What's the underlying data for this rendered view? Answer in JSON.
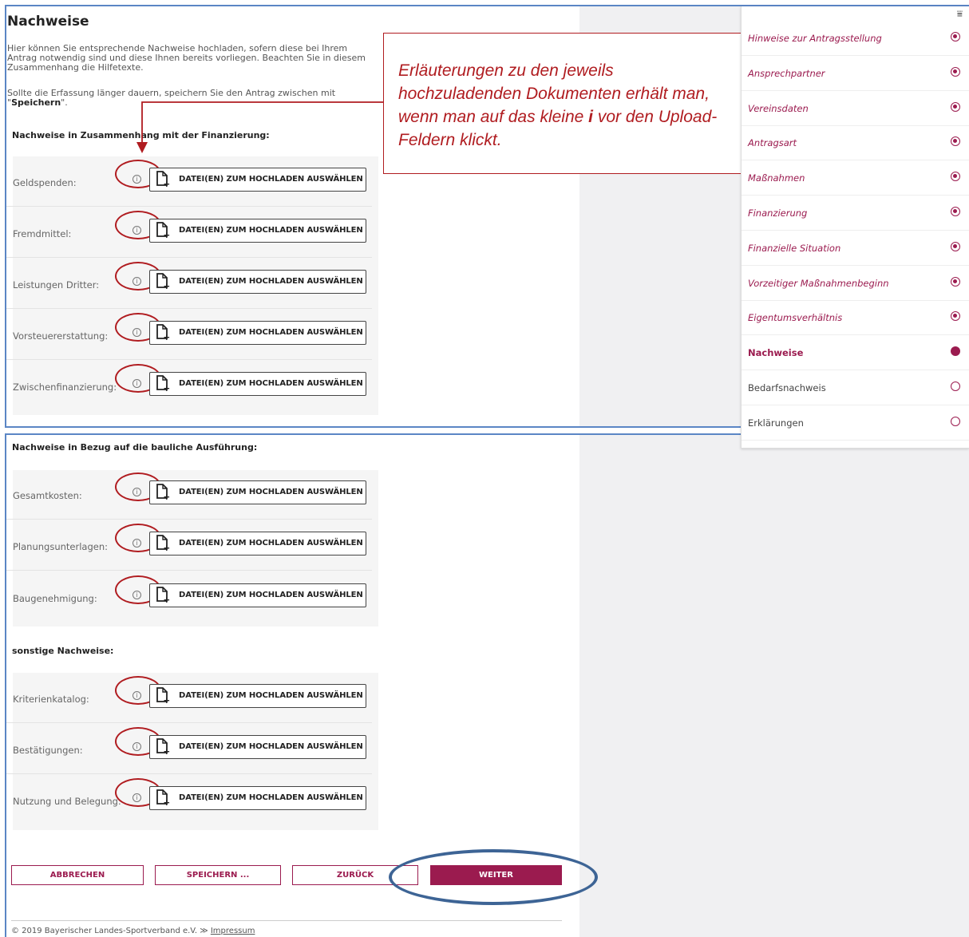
{
  "page": {
    "title": "Nachweise",
    "intro_1": "Hier können Sie entsprechende Nachweise hochladen, sofern diese bei Ihrem Antrag notwendig sind und diese Ihnen bereits vorliegen. Beachten Sie in diesem Zusammenhang die Hilfetexte.",
    "intro_2_pre": "Sollte die Erfassung länger dauern, speichern Sie den Antrag zwischen mit \"",
    "intro_2_bold": "Speichern",
    "intro_2_post": "\"."
  },
  "upload_button_label": "DATEI(EN) ZUM HOCHLADEN AUSWÄHLEN",
  "info_glyph": "i",
  "sections": [
    {
      "heading": "Nachweise in Zusammenhang mit der Finanzierung:",
      "items": [
        "Geldspenden:",
        "Fremdmittel:",
        "Leistungen Dritter:",
        "Vorsteuererstattung:",
        "Zwischenfinanzierung:"
      ]
    },
    {
      "heading": "Nachweise in Bezug auf die bauliche Ausführung:",
      "items": [
        "Gesamtkosten:",
        "Planungsunterlagen:",
        "Baugenehmigung:"
      ]
    },
    {
      "heading": "sonstige Nachweise:",
      "items": [
        "Kriterienkatalog:",
        "Bestätigungen:",
        "Nutzung und Belegung:"
      ]
    }
  ],
  "callout": {
    "text_a": "Erläuterungen zu den jeweils hochzuladenden Dokumenten erhält man, wenn man auf das kleine ",
    "text_i": "i",
    "text_b": " vor den Upload-Feldern klickt.",
    "color": "#b01c20"
  },
  "sidebar": {
    "filter_icon": "filter-icon",
    "items": [
      {
        "label": "Hinweise zur Antragsstellung",
        "status": "done"
      },
      {
        "label": "Ansprechpartner",
        "status": "done"
      },
      {
        "label": "Vereinsdaten",
        "status": "done"
      },
      {
        "label": "Antragsart",
        "status": "done"
      },
      {
        "label": "Maßnahmen",
        "status": "done"
      },
      {
        "label": "Finanzierung",
        "status": "done"
      },
      {
        "label": "Finanzielle Situation",
        "status": "done"
      },
      {
        "label": "Vorzeitiger Maßnahmenbeginn",
        "status": "done"
      },
      {
        "label": "Eigentumsverhältnis",
        "status": "done"
      },
      {
        "label": "Nachweise",
        "status": "current"
      },
      {
        "label": "Bedarfsnachweis",
        "status": "open"
      },
      {
        "label": "Erklärungen",
        "status": "open"
      }
    ]
  },
  "buttons": {
    "cancel": "ABBRECHEN",
    "save": "SPEICHERN ...",
    "back": "ZURÜCK",
    "next": "WEITER"
  },
  "footer": {
    "copyright": "© 2019 Bayerischer Landes-Sportverband e.V. ≫ ",
    "impressum": "Impressum"
  },
  "colors": {
    "brand": "#9b1b4f",
    "annotation_red": "#b01c20",
    "annotation_blue": "#3d6495",
    "panel_border": "#5b86c5"
  }
}
